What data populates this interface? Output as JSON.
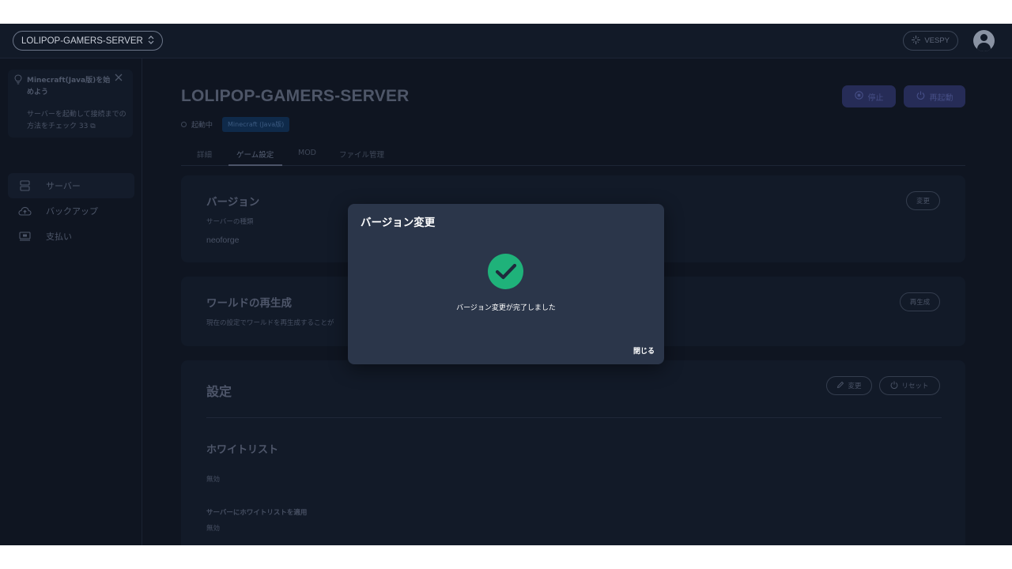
{
  "topbar": {
    "server_name": "LOLIPOP-GAMERS-SERVER",
    "selector_icon": "chevron-updown-icon",
    "user_name": "VESPY",
    "user_icon": "sparkle-icon",
    "avatar_icon": "user-avatar-icon"
  },
  "sidebar": {
    "tip": {
      "title": "Minecraft(Java版)を始めよう",
      "description": "サーバーを起動して接続までの方法をチェック",
      "description_icons": "33 ⧉"
    },
    "items": [
      {
        "label": "サーバー",
        "icon": "server-icon",
        "active": true
      },
      {
        "label": "バックアップ",
        "icon": "cloud-backup-icon",
        "active": false
      },
      {
        "label": "支払い",
        "icon": "payment-icon",
        "active": false
      }
    ]
  },
  "main": {
    "title": "LOLIPOP-GAMERS-SERVER",
    "status": "起動中",
    "edition_badge": "Minecraft (Java版)",
    "stop_label": "停止",
    "restart_label": "再起動",
    "tabs": [
      {
        "label": "詳細",
        "active": false
      },
      {
        "label": "ゲーム設定",
        "active": true
      },
      {
        "label": "MOD",
        "active": false
      },
      {
        "label": "ファイル管理",
        "active": false
      }
    ],
    "version_card": {
      "title": "バージョン",
      "type_label": "サーバーの種類",
      "type_value": "neoforge",
      "change_label": "変更"
    },
    "regen_card": {
      "title": "ワールドの再生成",
      "description": "現在の設定でワールドを再生成することが",
      "regen_label": "再生成"
    },
    "settings_card": {
      "title": "設定",
      "edit_label": "変更",
      "reset_label": "リセット",
      "whitelist_title": "ホワイトリスト",
      "whitelist_value": "無効",
      "apply_label": "サーバーにホワイトリストを適用",
      "apply_value": "無効"
    }
  },
  "modal": {
    "title": "バージョン変更",
    "message": "バージョン変更が完了しました",
    "close_label": "閉じる",
    "icon": "check-circle-icon",
    "accent": "#1fb27a"
  }
}
